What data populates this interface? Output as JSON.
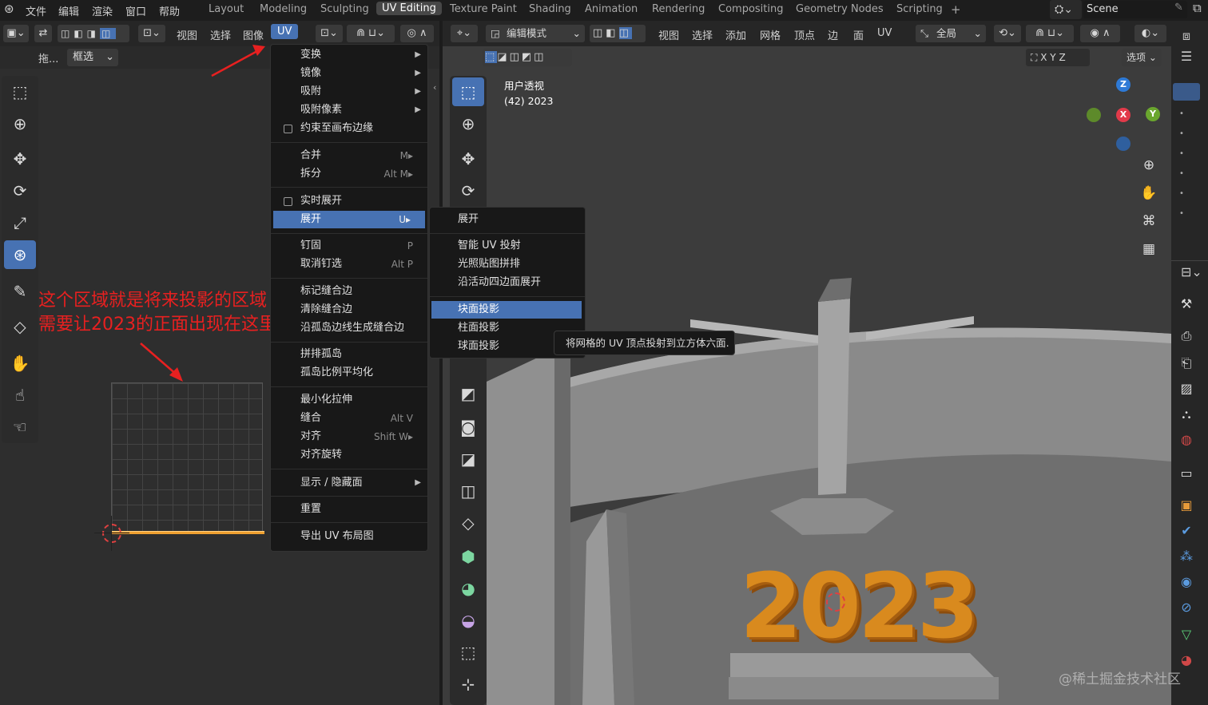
{
  "topbar": {
    "menus": [
      "文件",
      "编辑",
      "渲染",
      "窗口",
      "帮助"
    ],
    "workspaces": [
      "Layout",
      "Modeling",
      "Sculpting",
      "UV Editing",
      "Texture Paint",
      "Shading",
      "Animation",
      "Rendering",
      "Compositing",
      "Geometry Nodes",
      "Scripting",
      "+"
    ],
    "active_workspace": "UV Editing",
    "scene": "Scene"
  },
  "uv_editor": {
    "header_menus": [
      "视图",
      "选择",
      "图像",
      "UV"
    ],
    "active_menu": "UV",
    "drag_label": "拖...",
    "select_mode": "框选"
  },
  "uv_menu": {
    "items": [
      {
        "label": "变换",
        "shortcut": "",
        "submenu": true
      },
      {
        "label": "镜像",
        "shortcut": "",
        "submenu": true
      },
      {
        "label": "吸附",
        "shortcut": "",
        "submenu": true
      },
      {
        "label": "吸附像素",
        "shortcut": "",
        "submenu": true
      },
      {
        "label": "约束至画布边缘",
        "shortcut": "",
        "checkbox": true
      },
      {
        "label": "合并",
        "shortcut": "M▸"
      },
      {
        "label": "拆分",
        "shortcut": "Alt M▸"
      },
      {
        "label": "实时展开",
        "shortcut": "",
        "checkbox": true
      },
      {
        "label": "展开",
        "shortcut": "U▸",
        "highlighted": true
      },
      {
        "label": "钉固",
        "shortcut": "P"
      },
      {
        "label": "取消钉选",
        "shortcut": "Alt P"
      },
      {
        "label": "标记缝合边",
        "shortcut": ""
      },
      {
        "label": "清除缝合边",
        "shortcut": ""
      },
      {
        "label": "沿孤岛边线生成缝合边",
        "shortcut": ""
      },
      {
        "label": "拼排孤岛",
        "shortcut": ""
      },
      {
        "label": "孤岛比例平均化",
        "shortcut": ""
      },
      {
        "label": "最小化拉伸",
        "shortcut": ""
      },
      {
        "label": "缝合",
        "shortcut": "Alt V"
      },
      {
        "label": "对齐",
        "shortcut": "Shift W▸"
      },
      {
        "label": "对齐旋转",
        "shortcut": ""
      },
      {
        "label": "显示 / 隐藏面",
        "shortcut": "",
        "submenu": true
      },
      {
        "label": "重置",
        "shortcut": ""
      },
      {
        "label": "导出 UV 布局图",
        "shortcut": ""
      }
    ]
  },
  "unwrap_submenu": {
    "items": [
      "展开",
      "智能 UV 投射",
      "光照贴图拼排",
      "沿活动四边面展开",
      "块面投影",
      "柱面投影",
      "球面投影"
    ],
    "highlighted": "块面投影"
  },
  "tooltip": "将网格的 UV 顶点投射到立方体六面.",
  "viewport": {
    "header_menus": [
      "视图",
      "选择",
      "添加",
      "网格",
      "顶点",
      "边",
      "面",
      "UV"
    ],
    "mode": "编辑模式",
    "orientation": "全局",
    "options_label": "选项",
    "axes": [
      "X",
      "Y",
      "Z"
    ],
    "view_name": "用户透视",
    "object_info": "(42) 2023"
  },
  "annotation": {
    "line1": "这个区域就是将来投影的区域",
    "line2": "需要让2023的正面出现在这里"
  },
  "watermark": "@稀土掘金技术社区",
  "scene_text": "2023",
  "colors": {
    "accent": "#4772b3",
    "annotation": "#e82020",
    "text_3d": "#d98a1e"
  }
}
